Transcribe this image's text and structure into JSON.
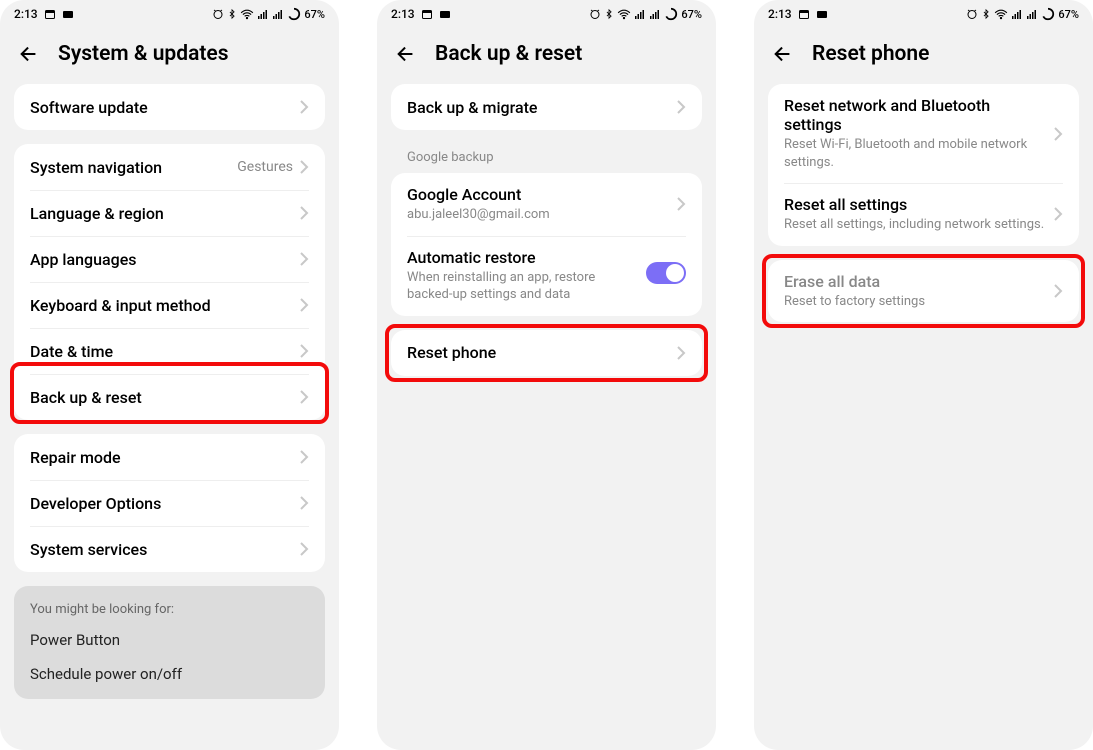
{
  "status": {
    "time": "2:13",
    "battery": "67%"
  },
  "screen1": {
    "title": "System & updates",
    "group1": {
      "software_update": "Software update"
    },
    "group2": {
      "system_nav": "System navigation",
      "system_nav_value": "Gestures",
      "lang_region": "Language & region",
      "app_langs": "App languages",
      "keyboard": "Keyboard & input method",
      "datetime": "Date & time",
      "backup_reset": "Back up & reset"
    },
    "group3": {
      "repair": "Repair mode",
      "dev": "Developer Options",
      "services": "System services"
    },
    "suggest": {
      "label": "You might be looking for:",
      "item1": "Power Button",
      "item2": "Schedule power on/off"
    }
  },
  "screen2": {
    "title": "Back up & reset",
    "backup_migrate": "Back up & migrate",
    "section_label": "Google backup",
    "google_account": "Google Account",
    "google_email": "abu.jaleel30@gmail.com",
    "auto_restore": "Automatic restore",
    "auto_restore_desc": "When reinstalling an app, restore backed-up settings and data",
    "reset_phone": "Reset phone"
  },
  "screen3": {
    "title": "Reset phone",
    "reset_net": "Reset network and Bluetooth settings",
    "reset_net_desc": "Reset Wi-Fi, Bluetooth and mobile network settings.",
    "reset_all": "Reset all settings",
    "reset_all_desc": "Reset all settings, including network settings.",
    "erase": "Erase all data",
    "erase_desc": "Reset to factory settings"
  }
}
